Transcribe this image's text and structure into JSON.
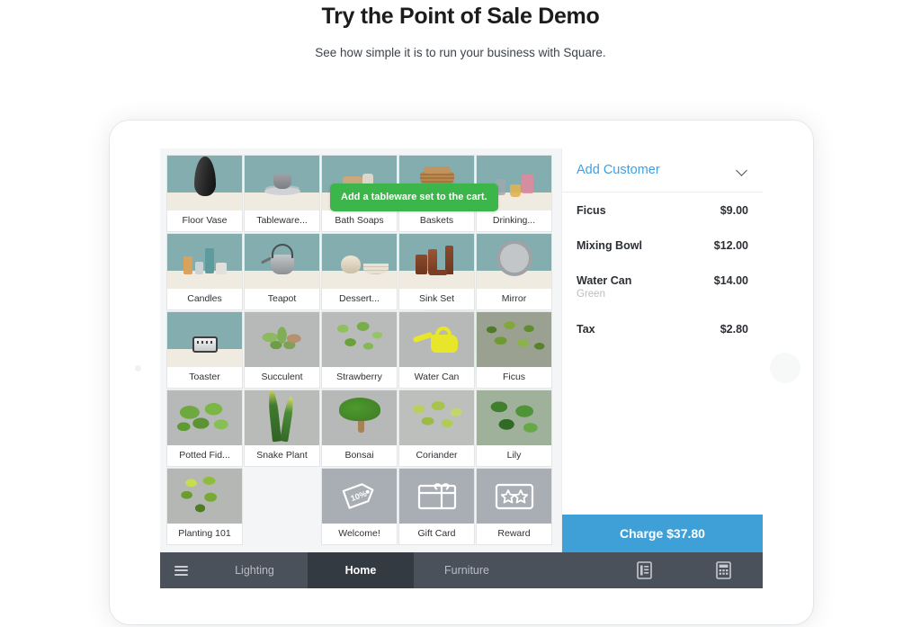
{
  "hero": {
    "title": "Try the Point of Sale Demo",
    "subtitle": "See how simple it is to run your business with Square."
  },
  "tooltip": {
    "text": "Add a tableware set to the cart."
  },
  "grid": {
    "tiles": [
      {
        "label": "Floor Vase",
        "kind": "shelf",
        "art": "vase",
        "highlight": false
      },
      {
        "label": "Tableware...",
        "kind": "shelf",
        "art": "tableware",
        "highlight": true
      },
      {
        "label": "Bath Soaps",
        "kind": "shelf",
        "art": "soaps",
        "highlight": false
      },
      {
        "label": "Baskets",
        "kind": "shelf",
        "art": "baskets",
        "highlight": false
      },
      {
        "label": "Drinking...",
        "kind": "shelf",
        "art": "glasses",
        "highlight": false
      },
      {
        "label": "Candles",
        "kind": "shelf",
        "art": "candles",
        "highlight": false
      },
      {
        "label": "Teapot",
        "kind": "shelf",
        "art": "teapot",
        "highlight": false
      },
      {
        "label": "Dessert...",
        "kind": "shelf",
        "art": "dessert",
        "highlight": false
      },
      {
        "label": "Sink Set",
        "kind": "shelf",
        "art": "sinkset",
        "highlight": false
      },
      {
        "label": "Mirror",
        "kind": "shelf",
        "art": "mirror",
        "highlight": false
      },
      {
        "label": "Toaster",
        "kind": "shelf",
        "art": "toaster",
        "highlight": false
      },
      {
        "label": "Succulent",
        "kind": "photo",
        "art": "succulent",
        "highlight": false
      },
      {
        "label": "Strawberry",
        "kind": "photo",
        "art": "strawberry",
        "highlight": false
      },
      {
        "label": "Water Can",
        "kind": "photo",
        "art": "watercan",
        "highlight": false
      },
      {
        "label": "Ficus",
        "kind": "photo",
        "art": "ficus",
        "highlight": false
      },
      {
        "label": "Potted Fid...",
        "kind": "photo",
        "art": "leafy",
        "highlight": false
      },
      {
        "label": "Snake Plant",
        "kind": "photo",
        "art": "snake",
        "highlight": false
      },
      {
        "label": "Bonsai",
        "kind": "photo",
        "art": "bonsai",
        "highlight": false
      },
      {
        "label": "Coriander",
        "kind": "photo",
        "art": "coriander",
        "highlight": false
      },
      {
        "label": "Lily",
        "kind": "photo",
        "art": "lily",
        "highlight": false
      },
      {
        "label": "Planting 101",
        "kind": "photo",
        "art": "planting",
        "highlight": false
      },
      {
        "label": "",
        "kind": "empty",
        "art": "none",
        "highlight": false
      },
      {
        "label": "Welcome!",
        "kind": "icon",
        "art": "discount-tag-icon",
        "highlight": false
      },
      {
        "label": "Gift Card",
        "kind": "icon",
        "art": "gift-card-icon",
        "highlight": false
      },
      {
        "label": "Reward",
        "kind": "icon",
        "art": "reward-stars-icon",
        "highlight": false
      }
    ]
  },
  "cart": {
    "add_customer_label": "Add Customer",
    "chevron_icon": "chevron-down-icon",
    "items": [
      {
        "name": "Ficus",
        "variant": "",
        "amount": "$9.00"
      },
      {
        "name": "Mixing Bowl",
        "variant": "",
        "amount": "$12.00"
      },
      {
        "name": "Water Can",
        "variant": "Green",
        "amount": "$14.00"
      },
      {
        "name": "Tax",
        "variant": "",
        "amount": "$2.80"
      }
    ],
    "charge_label": "Charge $37.80"
  },
  "nav": {
    "menu_icon": "hamburger-menu-icon",
    "tabs": [
      {
        "label": "Lighting",
        "active": false
      },
      {
        "label": "Home",
        "active": true
      },
      {
        "label": "Furniture",
        "active": false
      }
    ],
    "icons": [
      {
        "name": "receipt-icon"
      },
      {
        "name": "calculator-icon"
      }
    ]
  },
  "colors": {
    "accent_blue": "#3fa0d8",
    "link_blue": "#3fa0e0",
    "tooltip_green": "#3cb54a",
    "nav_bg": "#4a515b",
    "nav_active": "#343a42"
  }
}
